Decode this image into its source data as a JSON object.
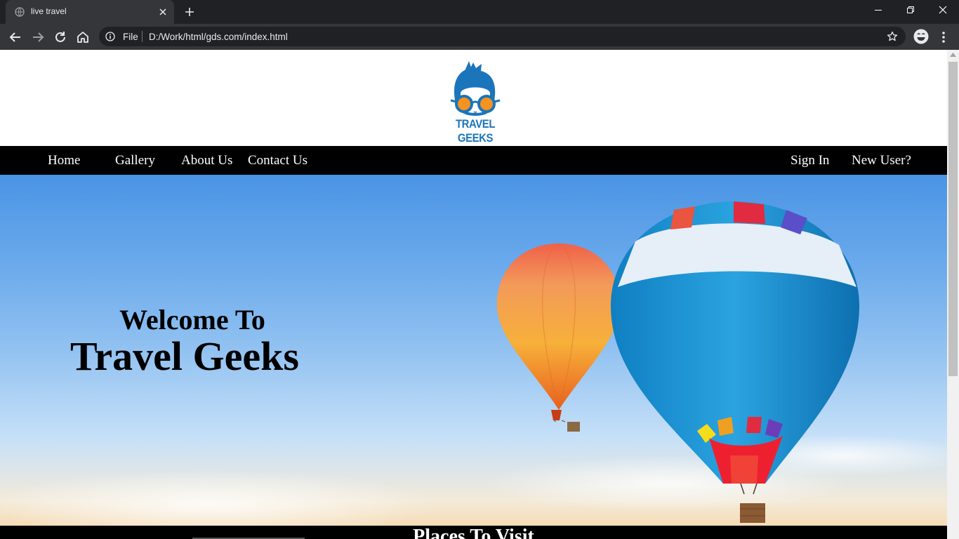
{
  "browser": {
    "tab_title": "live travel",
    "url_scheme": "File",
    "url": "D:/Work/html/gds.com/index.html"
  },
  "site": {
    "logo_text": "TRAVEL GEEKS",
    "nav": {
      "home": "Home",
      "gallery": "Gallery",
      "about": "About Us",
      "contact": "Contact Us",
      "sign_in": "Sign In",
      "new_user": "New User?"
    },
    "hero": {
      "welcome": "Welcome To",
      "title": "Travel Geeks"
    },
    "section_heading": "Places To Visit"
  },
  "colors": {
    "brand_blue": "#1b75bb",
    "brand_orange": "#f6921e",
    "nav_bg": "#000000"
  }
}
